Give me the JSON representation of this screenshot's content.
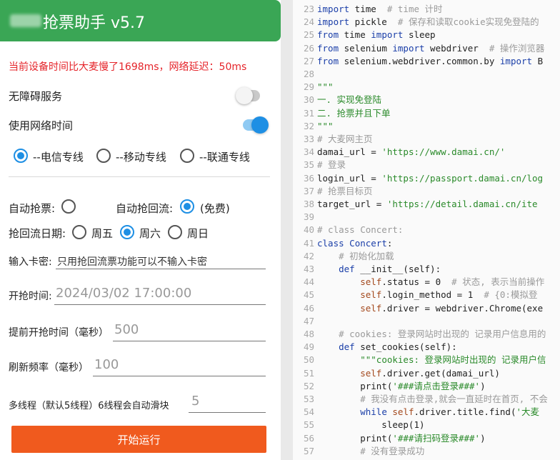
{
  "app": {
    "title": "抢票助手 v5.7",
    "delay_message": "当前设备时间比大麦慢了1698ms，网络延迟：50ms",
    "accessibility": {
      "label": "无障碍服务",
      "enabled": false
    },
    "network_time": {
      "label": "使用网络时间",
      "enabled": true
    },
    "lines": [
      {
        "label": "--电信专线",
        "selected": true
      },
      {
        "label": "--移动专线",
        "selected": false
      },
      {
        "label": "--联通专线",
        "selected": false
      }
    ],
    "auto_grab": {
      "label": "自动抢票:",
      "selected": false
    },
    "auto_return": {
      "label": "自动抢回流:",
      "option": "(免费)",
      "selected": true
    },
    "return_date": {
      "label": "抢回流日期:",
      "options": [
        {
          "label": "周五",
          "selected": false
        },
        {
          "label": "周六",
          "selected": true
        },
        {
          "label": "周日",
          "selected": false
        }
      ]
    },
    "card_key": {
      "label": "输入卡密:",
      "placeholder": "只用抢回流票功能可以不输入卡密"
    },
    "start_time": {
      "label": "开抢时间:",
      "value": "2024/03/02 17:00:00"
    },
    "advance_time": {
      "label": "提前开抢时间（毫秒）",
      "value": "500"
    },
    "refresh_rate": {
      "label": "刷新频率（毫秒）",
      "value": "100"
    },
    "threads": {
      "label": "多线程（默认5线程）6线程会自动滑块",
      "value": "5"
    },
    "start_button": "开始运行"
  },
  "code": {
    "lines": [
      {
        "n": "23",
        "tokens": [
          [
            "kw",
            "import"
          ],
          [
            "pl",
            " time  "
          ],
          [
            "cm",
            "# time 计时"
          ]
        ]
      },
      {
        "n": "24",
        "tokens": [
          [
            "kw",
            "import"
          ],
          [
            "pl",
            " pickle  "
          ],
          [
            "cm",
            "# 保存和读取cookie实现免登陆的"
          ]
        ]
      },
      {
        "n": "25",
        "tokens": [
          [
            "kw",
            "from"
          ],
          [
            "pl",
            " time "
          ],
          [
            "kw",
            "import"
          ],
          [
            "pl",
            " sleep"
          ]
        ]
      },
      {
        "n": "26",
        "tokens": [
          [
            "kw",
            "from"
          ],
          [
            "pl",
            " selenium "
          ],
          [
            "kw",
            "import"
          ],
          [
            "pl",
            " webdriver  "
          ],
          [
            "cm",
            "# 操作浏览器"
          ]
        ]
      },
      {
        "n": "27",
        "tokens": [
          [
            "kw",
            "from"
          ],
          [
            "pl",
            " selenium.webdriver.common.by "
          ],
          [
            "kw",
            "import"
          ],
          [
            "pl",
            " B"
          ]
        ]
      },
      {
        "n": "28",
        "tokens": []
      },
      {
        "n": "29",
        "tokens": [
          [
            "str",
            "\"\"\""
          ]
        ]
      },
      {
        "n": "30",
        "tokens": [
          [
            "str",
            "一. 实现免登陆"
          ]
        ]
      },
      {
        "n": "31",
        "tokens": [
          [
            "str",
            "二. 抢票并且下单"
          ]
        ]
      },
      {
        "n": "32",
        "tokens": [
          [
            "str",
            "\"\"\""
          ]
        ]
      },
      {
        "n": "33",
        "tokens": [
          [
            "cm",
            "# 大麦网主页"
          ]
        ]
      },
      {
        "n": "34",
        "tokens": [
          [
            "pl",
            "damai_url = "
          ],
          [
            "str",
            "'https://www.damai.cn/'"
          ]
        ]
      },
      {
        "n": "35",
        "tokens": [
          [
            "cm",
            "# 登录"
          ]
        ]
      },
      {
        "n": "36",
        "tokens": [
          [
            "pl",
            "login_url = "
          ],
          [
            "str",
            "'https://passport.damai.cn/log"
          ]
        ]
      },
      {
        "n": "37",
        "tokens": [
          [
            "cm",
            "# 抢票目标页"
          ]
        ]
      },
      {
        "n": "38",
        "tokens": [
          [
            "pl",
            "target_url = "
          ],
          [
            "str",
            "'https://detail.damai.cn/ite"
          ]
        ]
      },
      {
        "n": "39",
        "tokens": []
      },
      {
        "n": "40",
        "tokens": [
          [
            "cm",
            "# class Concert:"
          ]
        ]
      },
      {
        "n": "41",
        "tokens": [
          [
            "kw",
            "class"
          ],
          [
            "pl",
            " "
          ],
          [
            "kw",
            "Concert"
          ],
          [
            "pl",
            ":"
          ]
        ]
      },
      {
        "n": "42",
        "tokens": [
          [
            "pl",
            "    "
          ],
          [
            "cm",
            "# 初始化加载"
          ]
        ]
      },
      {
        "n": "43",
        "tokens": [
          [
            "pl",
            "    "
          ],
          [
            "kw",
            "def"
          ],
          [
            "pl",
            " __init__(self):"
          ]
        ]
      },
      {
        "n": "44",
        "tokens": [
          [
            "pl",
            "        "
          ],
          [
            "self",
            "self"
          ],
          [
            "pl",
            ".status = 0  "
          ],
          [
            "cm",
            "# 状态, 表示当前操作"
          ]
        ]
      },
      {
        "n": "45",
        "tokens": [
          [
            "pl",
            "        "
          ],
          [
            "self",
            "self"
          ],
          [
            "pl",
            ".login_method = 1  "
          ],
          [
            "cm",
            "# {0:模拟登"
          ]
        ]
      },
      {
        "n": "46",
        "tokens": [
          [
            "pl",
            "        "
          ],
          [
            "self",
            "self"
          ],
          [
            "pl",
            ".driver = webdriver.Chrome(exe"
          ]
        ]
      },
      {
        "n": "47",
        "tokens": []
      },
      {
        "n": "48",
        "tokens": [
          [
            "pl",
            "    "
          ],
          [
            "cm",
            "# cookies: 登录网站时出现的 记录用户信息用的"
          ]
        ]
      },
      {
        "n": "49",
        "tokens": [
          [
            "pl",
            "    "
          ],
          [
            "kw",
            "def"
          ],
          [
            "pl",
            " set_cookies(self):"
          ]
        ]
      },
      {
        "n": "50",
        "tokens": [
          [
            "pl",
            "        "
          ],
          [
            "str",
            "\"\"\"cookies: 登录网站时出现的 记录用户信"
          ]
        ]
      },
      {
        "n": "51",
        "tokens": [
          [
            "pl",
            "        "
          ],
          [
            "self",
            "self"
          ],
          [
            "pl",
            ".driver.get(damai_url)"
          ]
        ]
      },
      {
        "n": "52",
        "tokens": [
          [
            "pl",
            "        print("
          ],
          [
            "str",
            "'###请点击登录###'"
          ],
          [
            "pl",
            ")"
          ]
        ]
      },
      {
        "n": "53",
        "tokens": [
          [
            "pl",
            "        "
          ],
          [
            "cm",
            "# 我没有点击登录,就会一直延时在首页, 不会"
          ]
        ]
      },
      {
        "n": "54",
        "tokens": [
          [
            "pl",
            "        "
          ],
          [
            "kw",
            "while"
          ],
          [
            "pl",
            " "
          ],
          [
            "self",
            "self"
          ],
          [
            "pl",
            ".driver.title.find("
          ],
          [
            "str",
            "'大麦"
          ]
        ]
      },
      {
        "n": "55",
        "tokens": [
          [
            "pl",
            "            sleep(1)"
          ]
        ]
      },
      {
        "n": "56",
        "tokens": [
          [
            "pl",
            "        print("
          ],
          [
            "str",
            "'###请扫码登录###'"
          ],
          [
            "pl",
            ")"
          ]
        ]
      },
      {
        "n": "57",
        "tokens": [
          [
            "pl",
            "        "
          ],
          [
            "cm",
            "# 没有登录成功"
          ]
        ]
      }
    ]
  }
}
